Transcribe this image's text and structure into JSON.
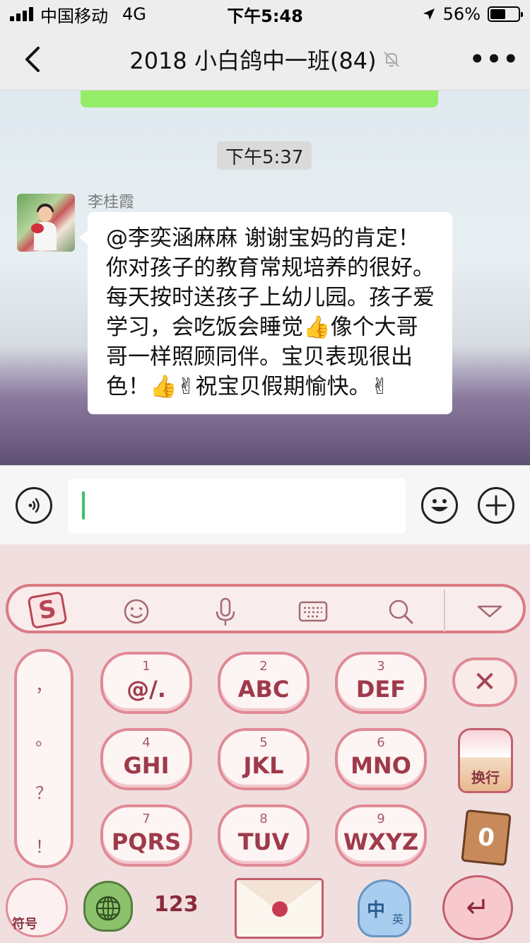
{
  "status_bar": {
    "carrier": "中国移动",
    "network": "4G",
    "time": "下午5:48",
    "battery_text": "56%",
    "battery_level": 0.56
  },
  "nav": {
    "title": "2018 小白鸽中一班(84)",
    "back_icon": "chevron-left-icon",
    "mute_icon": "bell-off-icon",
    "more_label": "•••"
  },
  "chat": {
    "time_badge": "下午5:37",
    "message": {
      "sender": "李桂霞",
      "text": "@李奕涵麻麻 谢谢宝妈的肯定！你对孩子的教育常规培养的很好。每天按时送孩子上幼儿园。孩子爱学习，会吃饭会睡觉👍像个大哥哥一样照顾同伴。宝贝表现很出色！👍✌祝宝贝假期愉快。✌"
    }
  },
  "input_bar": {
    "voice_icon": "voice-icon",
    "emoji_icon": "smiley-icon",
    "plus_icon": "plus-icon",
    "accent_color": "#3cc26a"
  },
  "keyboard": {
    "toolbar": {
      "logo": "S",
      "icons": [
        "emoji-icon",
        "microphone-icon",
        "keyboard-icon",
        "search-icon",
        "collapse-icon"
      ]
    },
    "punctuation": [
      "，",
      "。",
      "？",
      "！"
    ],
    "keys": [
      {
        "num": "1",
        "letters": "@/."
      },
      {
        "num": "2",
        "letters": "ABC"
      },
      {
        "num": "3",
        "letters": "DEF"
      },
      {
        "num": "4",
        "letters": "GHI"
      },
      {
        "num": "5",
        "letters": "JKL"
      },
      {
        "num": "6",
        "letters": "MNO"
      },
      {
        "num": "7",
        "letters": "PQRS"
      },
      {
        "num": "8",
        "letters": "TUV"
      },
      {
        "num": "9",
        "letters": "WXYZ"
      }
    ],
    "delete_label": "✕",
    "newline_label": "换行",
    "zero_label": "0",
    "symbol_label": "符号",
    "num_label": "123",
    "lang_zh": "中",
    "lang_en": "英",
    "enter_label": "↵"
  }
}
